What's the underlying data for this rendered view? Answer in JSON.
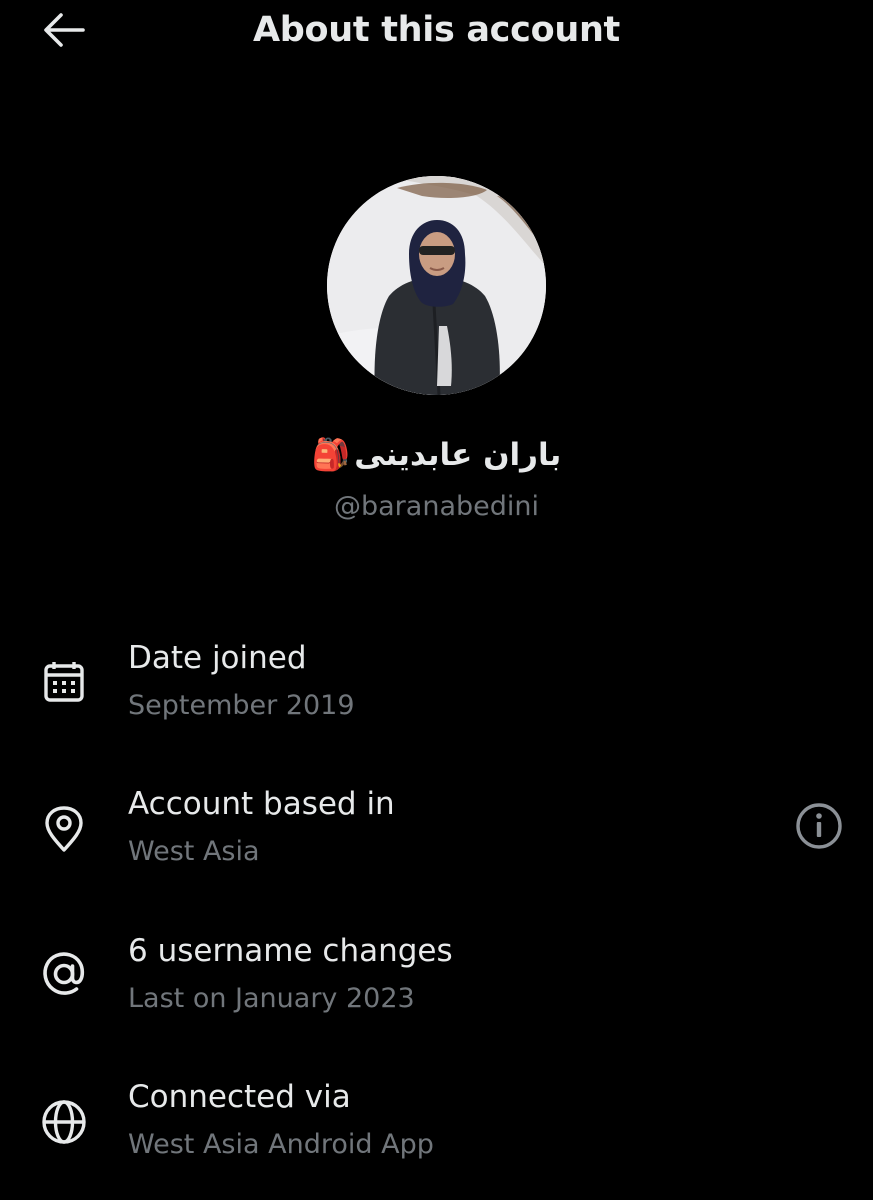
{
  "header": {
    "title": "About this account",
    "back_icon": "arrow-left-icon"
  },
  "profile": {
    "display_name": "باران عابدینی",
    "emoji": "🎒",
    "handle": "@baranabedini"
  },
  "info": [
    {
      "icon": "calendar-icon",
      "title": "Date joined",
      "subtitle": "September 2019"
    },
    {
      "icon": "location-pin-icon",
      "title": "Account based in",
      "subtitle": "West Asia",
      "action_icon": "info-icon"
    },
    {
      "icon": "at-sign-icon",
      "title": "6 username changes",
      "subtitle": "Last on January 2023"
    },
    {
      "icon": "globe-icon",
      "title": "Connected via",
      "subtitle": "West Asia Android App"
    }
  ],
  "colors": {
    "background": "#000000",
    "primary_text": "#e7e9ea",
    "secondary_text": "#71767b"
  }
}
